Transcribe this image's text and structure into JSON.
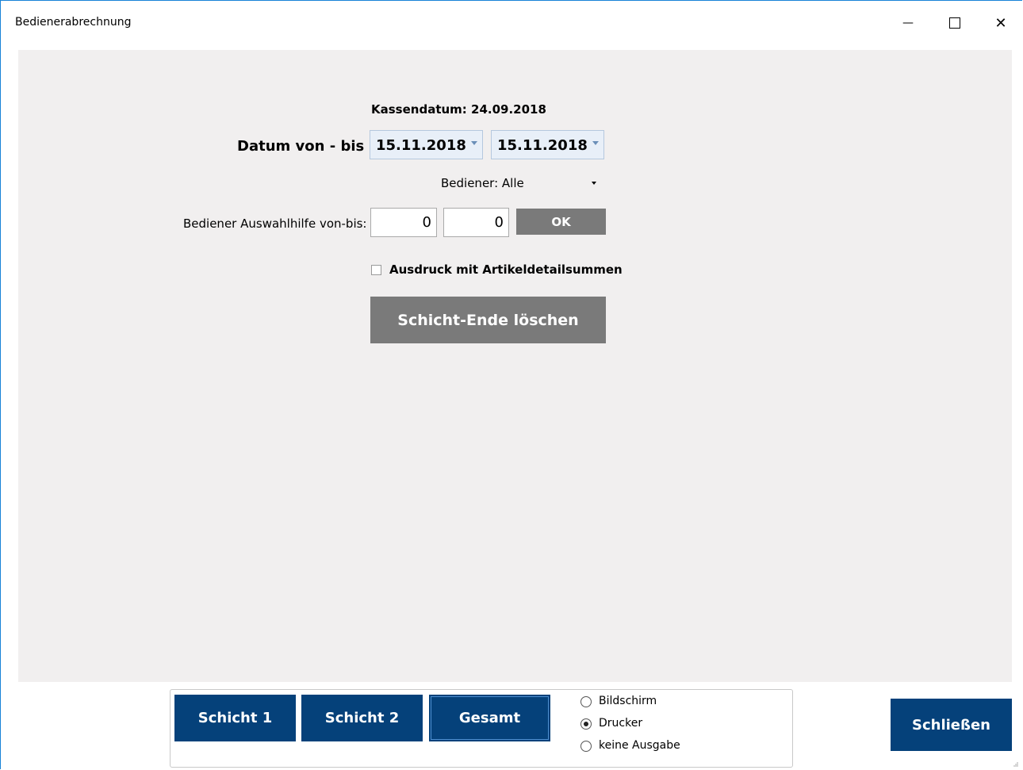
{
  "window": {
    "title": "Bedienerabrechnung",
    "minimize_glyph": "—",
    "maximize_glyph": "☐",
    "close_glyph": "✕"
  },
  "form": {
    "kassendatum": "Kassendatum: 24.09.2018",
    "datum_label": "Datum von - bis",
    "date_from": "15.11.2018",
    "date_to": "15.11.2018",
    "bediener": "Bediener: Alle",
    "auswahlhilfe_label": "Bediener Auswahlhilfe von-bis:",
    "auswahl_von": "0",
    "auswahl_bis": "0",
    "ok_label": "OK",
    "checkbox_label": "Ausdruck mit Artikeldetailsummen",
    "checkbox_checked": false,
    "schicht_ende_label": "Schicht-Ende löschen"
  },
  "footer": {
    "schicht1": "Schicht 1",
    "schicht2": "Schicht 2",
    "gesamt": "Gesamt",
    "output_options": [
      "Bildschirm",
      "Drucker",
      "keine Ausgabe"
    ],
    "selected_output": "Drucker",
    "close_label": "Schließen"
  },
  "colors": {
    "accent_blue": "#05417a",
    "panel_bg": "#f1efef",
    "gray_button": "#7a7a7a",
    "window_border": "#1883d7"
  }
}
